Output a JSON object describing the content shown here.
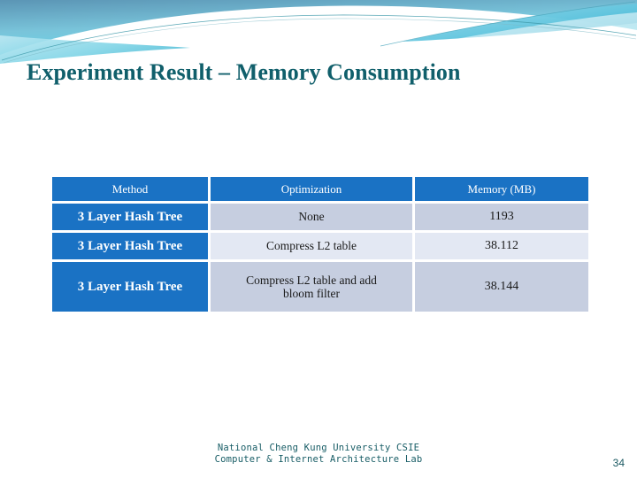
{
  "slide": {
    "title": "Experiment Result – Memory Consumption",
    "accent_color": "#1a72c4",
    "title_color": "#105f6b",
    "row_dark_color": "#c6cee0",
    "row_light_color": "#e3e8f3"
  },
  "table": {
    "headers": [
      "Method",
      "Optimization",
      "Memory (MB)"
    ],
    "rows": [
      {
        "method": "3 Layer Hash Tree",
        "optimization": "None",
        "memory": "1193"
      },
      {
        "method": "3 Layer Hash Tree",
        "optimization": "Compress L2 table",
        "memory": "38.112"
      },
      {
        "method": "3 Layer Hash Tree",
        "optimization_line1": "Compress L2 table and add",
        "optimization_line2": "bloom filter",
        "memory": "38.144"
      }
    ]
  },
  "footer": {
    "line1": "National Cheng Kung University CSIE",
    "line2": "Computer & Internet Architecture Lab",
    "page_number": "34"
  }
}
